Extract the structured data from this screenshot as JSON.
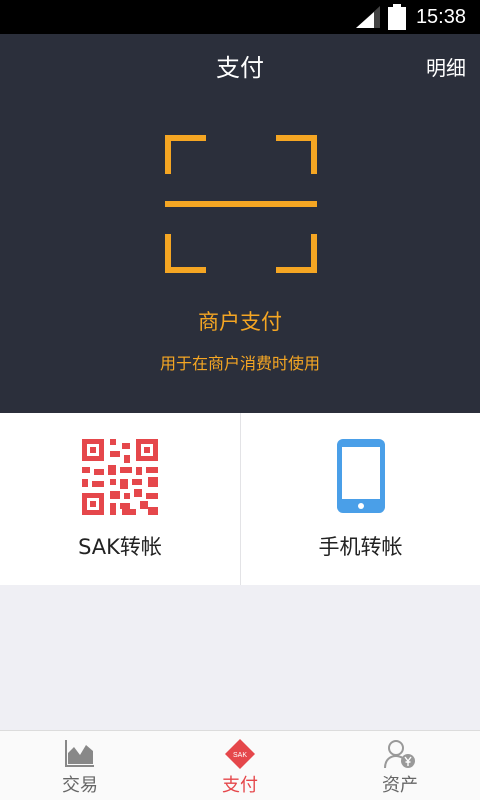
{
  "status_bar": {
    "time": "15:38"
  },
  "header": {
    "title": "支付",
    "detail_label": "明细"
  },
  "scan": {
    "label": "商户支付",
    "subtitle": "用于在商户消费时使用"
  },
  "actions": [
    {
      "label": "SAK转帐",
      "icon": "qr-code-icon",
      "color": "#e5474b"
    },
    {
      "label": "手机转帐",
      "icon": "phone-icon",
      "color": "#4a9fe8"
    }
  ],
  "tabbar": {
    "tabs": [
      {
        "label": "交易",
        "icon": "chart-icon",
        "active": false
      },
      {
        "label": "支付",
        "icon": "sak-diamond-icon",
        "badge": "SAK",
        "active": true
      },
      {
        "label": "资产",
        "icon": "user-yen-icon",
        "active": false
      }
    ]
  },
  "colors": {
    "accent": "#f5a623",
    "header_bg": "#2b2f3b",
    "active_tab": "#e5474b"
  }
}
